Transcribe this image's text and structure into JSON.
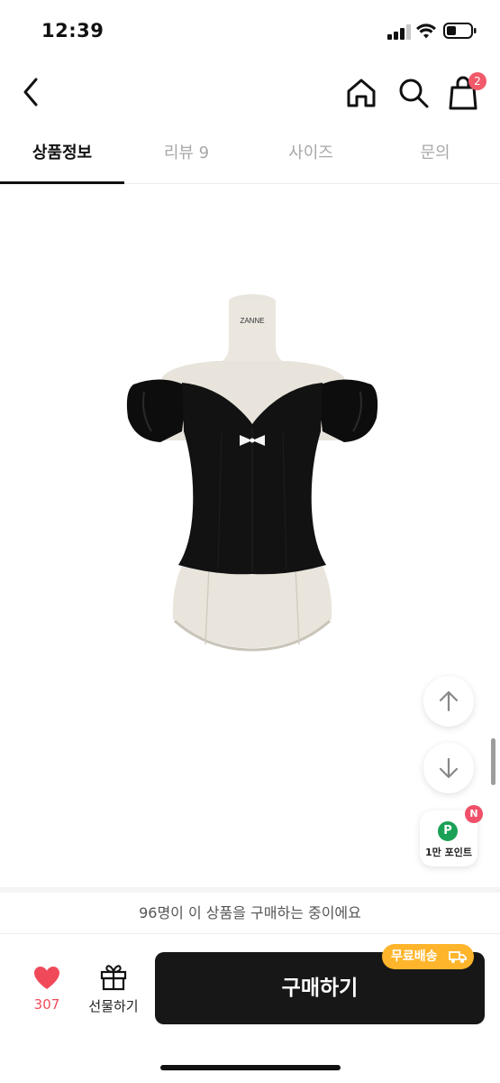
{
  "status_bar": {
    "time": "12:39"
  },
  "nav": {
    "back_icon": "chevron-left-icon",
    "home_icon": "home-icon",
    "search_icon": "search-icon",
    "cart_icon": "shopping-bag-icon",
    "cart_count": "2"
  },
  "tabs": [
    {
      "label": "상품정보",
      "active": true
    },
    {
      "label": "리뷰 9",
      "active": false
    },
    {
      "label": "사이즈",
      "active": false
    },
    {
      "label": "문의",
      "active": false
    }
  ],
  "product": {
    "mannequin_brand": "ZANNE"
  },
  "floating": {
    "scroll_up_icon": "arrow-up-icon",
    "scroll_down_icon": "arrow-down-icon",
    "point_badge": "P",
    "point_new": "N",
    "point_label": "1만 포인트"
  },
  "bottom": {
    "buyers_text": "96명이 이 상품을 구매하는 중이에요",
    "like_count": "307",
    "gift_label": "선물하기",
    "buy_label": "구매하기",
    "shipping_badge": "무료배송"
  },
  "colors": {
    "accent_red": "#f04a5a",
    "buy_button": "#171717",
    "shipping_badge": "#ffb52b",
    "point_green": "#1aa155"
  }
}
